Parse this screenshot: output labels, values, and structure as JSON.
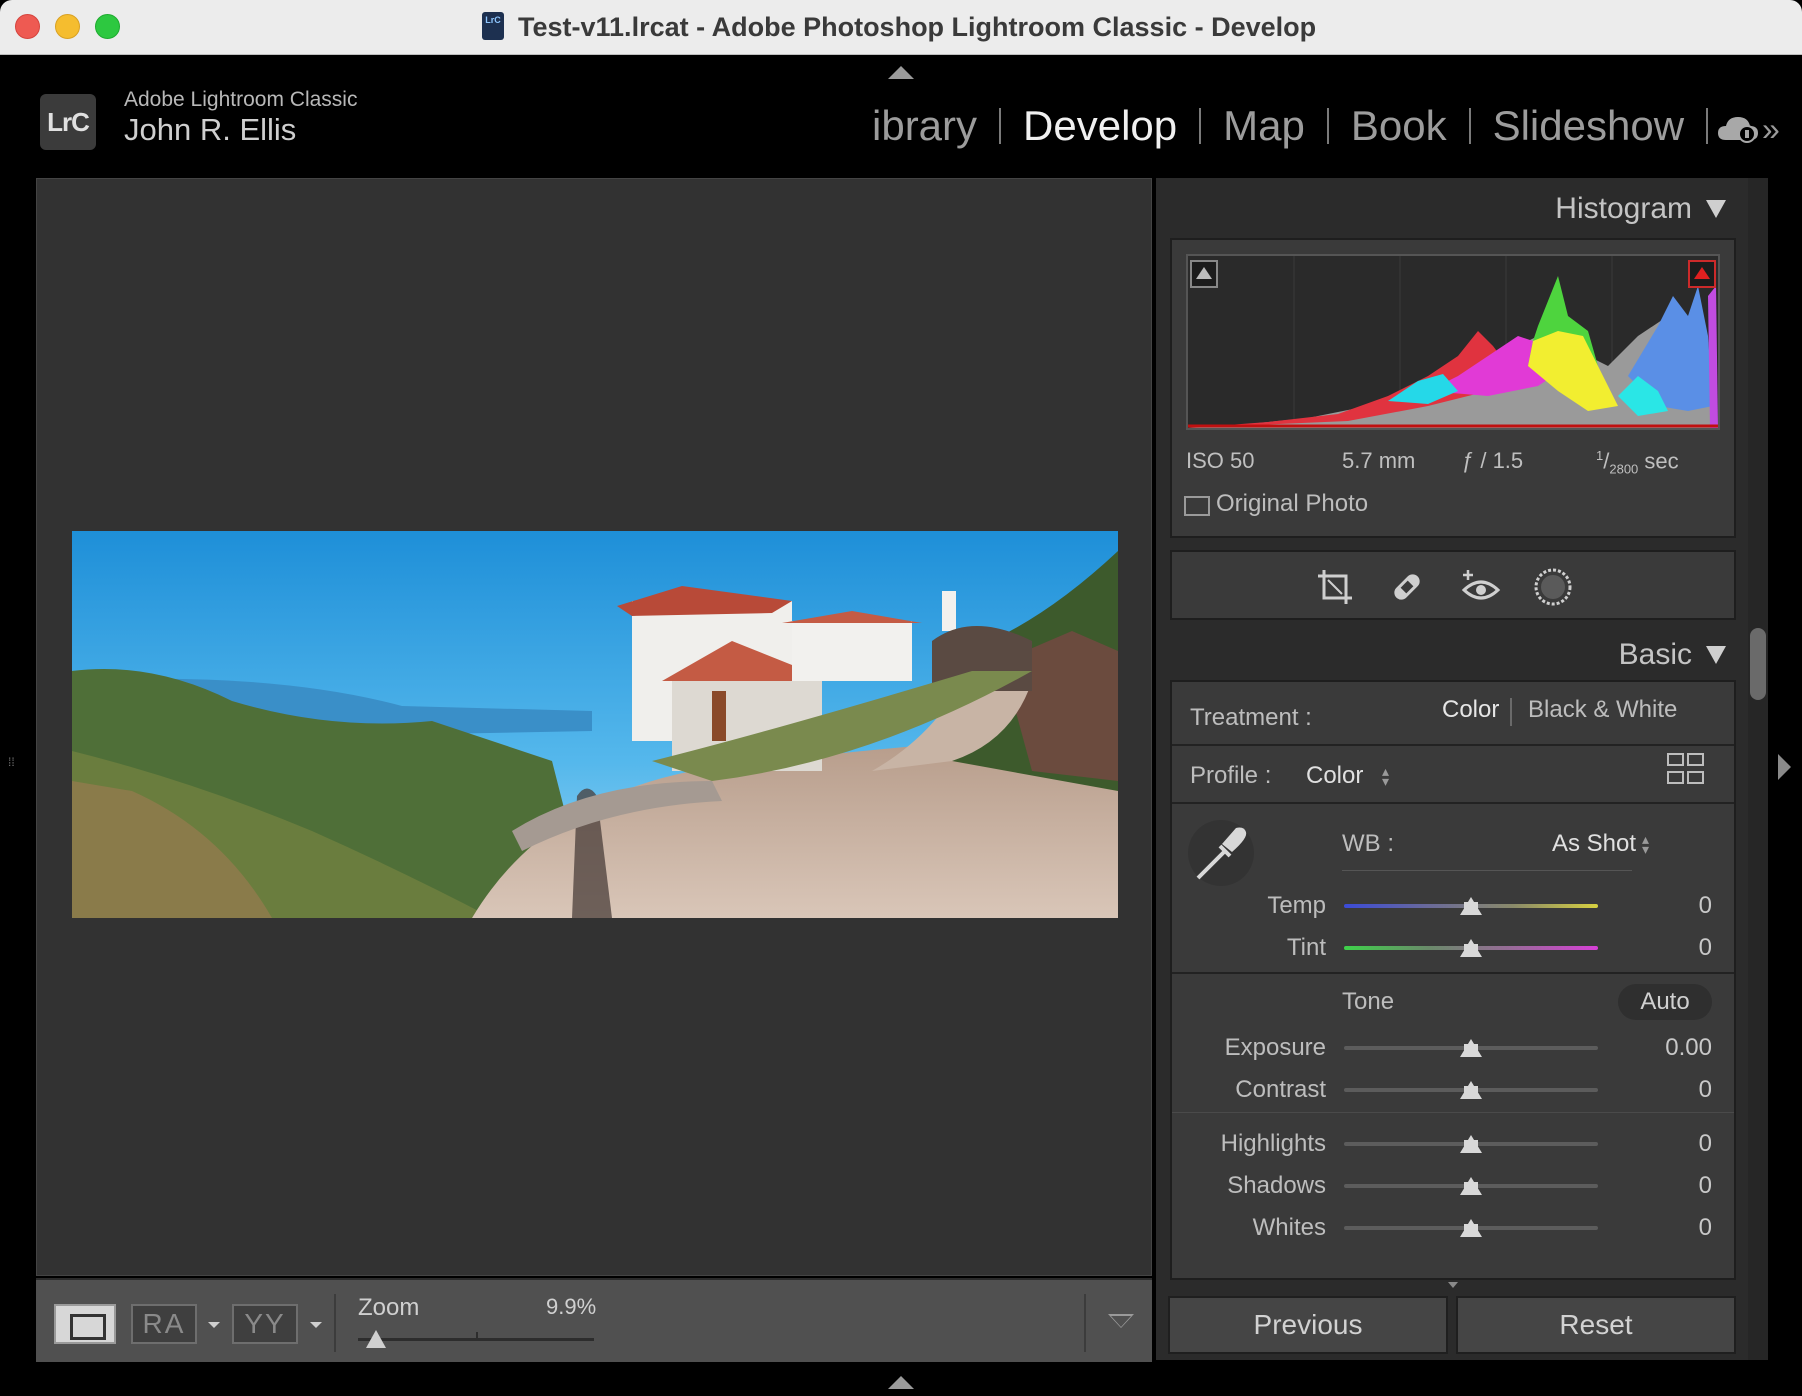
{
  "window": {
    "title": "Test-v11.lrcat - Adobe Photoshop Lightroom Classic - Develop",
    "doc_icon_text": "LrC"
  },
  "identity": {
    "logo": "LrC",
    "product": "Adobe Lightroom Classic",
    "user": "John R. Ellis"
  },
  "modules": [
    {
      "label": "ibrary",
      "active": false
    },
    {
      "label": "Develop",
      "active": true
    },
    {
      "label": "Map",
      "active": false
    },
    {
      "label": "Book",
      "active": false
    },
    {
      "label": "Slideshow",
      "active": false
    }
  ],
  "toolbar": {
    "ra_label": "RA",
    "yy_label": "YY",
    "zoom_label": "Zoom",
    "zoom_value": "9.9%"
  },
  "histogram": {
    "title": "Histogram",
    "iso": "ISO 50",
    "focal": "5.7 mm",
    "aperture": "ƒ / 1.5",
    "shutter_num": "1",
    "shutter_den": "2800",
    "shutter_unit": "sec",
    "original_label": "Original Photo"
  },
  "basic": {
    "title": "Basic",
    "treatment_label": "Treatment :",
    "treatment_color": "Color",
    "treatment_bw": "Black & White",
    "profile_label": "Profile :",
    "profile_value": "Color",
    "wb_label": "WB :",
    "wb_value": "As Shot",
    "tone_label": "Tone",
    "auto_label": "Auto",
    "sliders": [
      {
        "label": "Temp",
        "value": "0"
      },
      {
        "label": "Tint",
        "value": "0"
      },
      {
        "label": "Exposure",
        "value": "0.00"
      },
      {
        "label": "Contrast",
        "value": "0"
      },
      {
        "label": "Highlights",
        "value": "0"
      },
      {
        "label": "Shadows",
        "value": "0"
      },
      {
        "label": "Whites",
        "value": "0"
      }
    ]
  },
  "nav": {
    "previous": "Previous",
    "reset": "Reset"
  },
  "colors": {
    "accent_clip": "#e02020",
    "panel_bg": "#3a3a3a",
    "view_bg": "#323232"
  }
}
